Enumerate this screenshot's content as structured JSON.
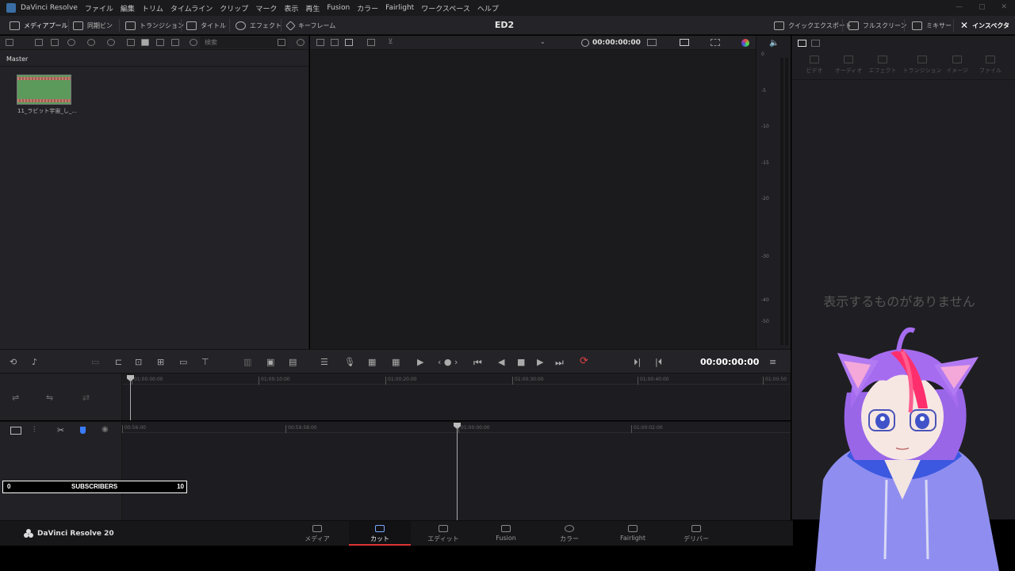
{
  "menubar": {
    "app_name": "DaVinci Resolve",
    "items": [
      "ファイル",
      "編集",
      "トリム",
      "タイムライン",
      "クリップ",
      "マーク",
      "表示",
      "再生",
      "Fusion",
      "カラー",
      "Fairlight",
      "ワークスペース",
      "ヘルプ"
    ]
  },
  "toolbar": {
    "media_pool": "メディアプール",
    "sync_bin": "同期ビン",
    "transitions": "トランジション",
    "titles": "タイトル",
    "effects": "エフェクト",
    "keyframes": "キーフレーム",
    "project_title": "ED2",
    "quick_export": "クイックエクスポート",
    "fullscreen": "フルスクリーン",
    "mixer": "ミキサー",
    "inspector": "インスペクタ"
  },
  "media_pool": {
    "search_placeholder": "検索",
    "bin_name": "Master",
    "clip_name": "11_ラビット宇宙_し_..."
  },
  "viewer": {
    "timecode": "00:00:00:00"
  },
  "meter": {
    "scale": [
      "0",
      "-5",
      "-10",
      "-15",
      "-20",
      "-30",
      "-40",
      "-50"
    ]
  },
  "inspector": {
    "tabs": [
      "ビデオ",
      "オーディオ",
      "エフェクト",
      "トランジション",
      "イメージ",
      "ファイル"
    ],
    "empty_message": "表示するものがありません"
  },
  "transport": {
    "timecode": "00:00:00:00"
  },
  "timeline_upper": {
    "ruler": [
      "01:00:00:00",
      "01:00:10:00",
      "01:00:20:00",
      "01:00:30:00",
      "01:00:40:00",
      "01:00:50"
    ]
  },
  "timeline_lower": {
    "ruler": [
      "00:56:00",
      "00:59:58:00",
      "01:00:00:00",
      "01:00:02:00"
    ]
  },
  "subscribers": {
    "min": "0",
    "label": "SUBSCRIBERS",
    "max": "10"
  },
  "pagebar": {
    "brand": "DaVinci Resolve 20",
    "tabs": [
      "メディア",
      "カット",
      "エディット",
      "Fusion",
      "カラー",
      "Fairlight",
      "デリバー"
    ],
    "active_tab": "カット"
  },
  "colors": {
    "accent_red": "#dd3333",
    "active_blue": "#7aa7ff",
    "loop_red": "#e04040"
  }
}
